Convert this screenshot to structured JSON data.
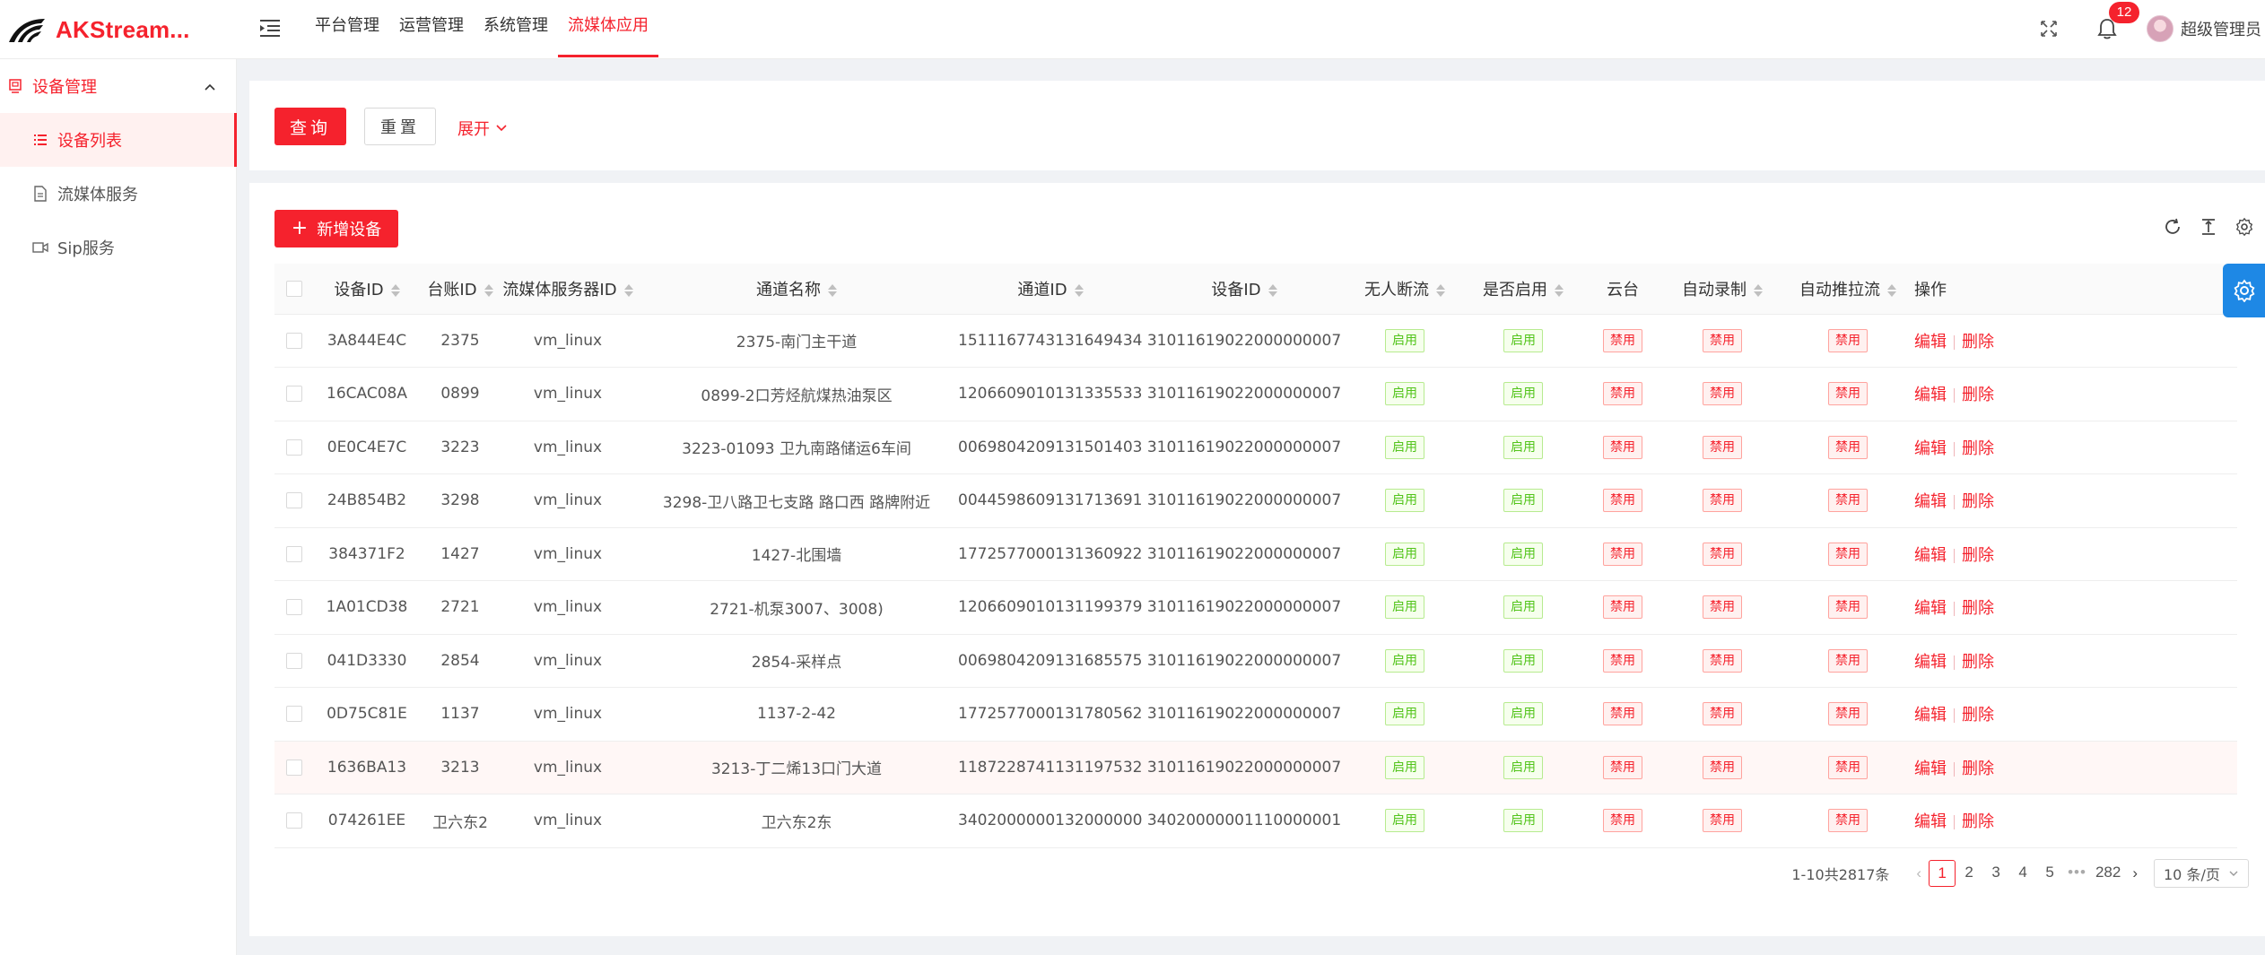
{
  "app": {
    "title": "AKStream..."
  },
  "top_nav": [
    "平台管理",
    "运营管理",
    "系统管理",
    "流媒体应用"
  ],
  "notifications": {
    "count": "12"
  },
  "user": {
    "name": "超级管理员"
  },
  "sidebar": {
    "group_label": "设备管理",
    "items": [
      {
        "label": "设备列表",
        "icon": "list-icon",
        "active": true
      },
      {
        "label": "流媒体服务",
        "icon": "file-icon",
        "active": false
      },
      {
        "label": "Sip服务",
        "icon": "video-icon",
        "active": false
      }
    ]
  },
  "search": {
    "query_label": "查询",
    "reset_label": "重置",
    "expand_label": "展开"
  },
  "toolbar": {
    "add_label": "新增设备"
  },
  "table": {
    "columns": [
      "设备ID",
      "台账ID",
      "流媒体服务器ID",
      "通道名称",
      "通道ID",
      "设备ID",
      "无人断流",
      "是否启用",
      "云台",
      "自动录制",
      "自动推拉流",
      "操作"
    ],
    "rows": [
      {
        "device_id": "3A844E4C",
        "ledger_id": "2375",
        "server_id": "vm_linux",
        "channel_name": "2375-南门主干道",
        "channel_id": "15111677431316494348",
        "dev_id2": "31011619022000000007",
        "no_user_stop": "启用",
        "enabled": "启用",
        "ptz": "禁用",
        "auto_record": "禁用",
        "auto_push": "禁用",
        "edit": "编辑",
        "delete": "删除"
      },
      {
        "device_id": "16CAC08A",
        "ledger_id": "0899",
        "server_id": "vm_linux",
        "channel_name": "0899-2口芳烃航煤热油泵区",
        "channel_id": "12066090101313355338",
        "dev_id2": "31011619022000000007",
        "no_user_stop": "启用",
        "enabled": "启用",
        "ptz": "禁用",
        "auto_record": "禁用",
        "auto_push": "禁用",
        "edit": "编辑",
        "delete": "删除"
      },
      {
        "device_id": "0E0C4E7C",
        "ledger_id": "3223",
        "server_id": "vm_linux",
        "channel_name": "3223-01093 卫九南路储运6车间",
        "channel_id": "00698042091315014038",
        "dev_id2": "31011619022000000007",
        "no_user_stop": "启用",
        "enabled": "启用",
        "ptz": "禁用",
        "auto_record": "禁用",
        "auto_push": "禁用",
        "edit": "编辑",
        "delete": "删除"
      },
      {
        "device_id": "24B854B2",
        "ledger_id": "3298",
        "server_id": "vm_linux",
        "channel_name": "3298-卫八路卫七支路 路口西 路牌附近",
        "channel_id": "00445986091317136918",
        "dev_id2": "31011619022000000007",
        "no_user_stop": "启用",
        "enabled": "启用",
        "ptz": "禁用",
        "auto_record": "禁用",
        "auto_push": "禁用",
        "edit": "编辑",
        "delete": "删除"
      },
      {
        "device_id": "384371F2",
        "ledger_id": "1427",
        "server_id": "vm_linux",
        "channel_name": "1427-北围墙",
        "channel_id": "17725770001313609224",
        "dev_id2": "31011619022000000007",
        "no_user_stop": "启用",
        "enabled": "启用",
        "ptz": "禁用",
        "auto_record": "禁用",
        "auto_push": "禁用",
        "edit": "编辑",
        "delete": "删除"
      },
      {
        "device_id": "1A01CD38",
        "ledger_id": "2721",
        "server_id": "vm_linux",
        "channel_name": "2721-机泵3007、3008)",
        "channel_id": "12066090101311993790",
        "dev_id2": "31011619022000000007",
        "no_user_stop": "启用",
        "enabled": "启用",
        "ptz": "禁用",
        "auto_record": "禁用",
        "auto_push": "禁用",
        "edit": "编辑",
        "delete": "删除"
      },
      {
        "device_id": "041D3330",
        "ledger_id": "2854",
        "server_id": "vm_linux",
        "channel_name": "2854-采样点",
        "channel_id": "00698042091316855750",
        "dev_id2": "31011619022000000007",
        "no_user_stop": "启用",
        "enabled": "启用",
        "ptz": "禁用",
        "auto_record": "禁用",
        "auto_push": "禁用",
        "edit": "编辑",
        "delete": "删除"
      },
      {
        "device_id": "0D75C81E",
        "ledger_id": "1137",
        "server_id": "vm_linux",
        "channel_name": "1137-2-42",
        "channel_id": "17725770001317805620",
        "dev_id2": "31011619022000000007",
        "no_user_stop": "启用",
        "enabled": "启用",
        "ptz": "禁用",
        "auto_record": "禁用",
        "auto_push": "禁用",
        "edit": "编辑",
        "delete": "删除"
      },
      {
        "device_id": "1636BA13",
        "ledger_id": "3213",
        "server_id": "vm_linux",
        "channel_name": "3213-丁二烯13口门大道",
        "channel_id": "11872287411311975327",
        "dev_id2": "31011619022000000007",
        "no_user_stop": "启用",
        "enabled": "启用",
        "ptz": "禁用",
        "auto_record": "禁用",
        "auto_push": "禁用",
        "edit": "编辑",
        "delete": "删除"
      },
      {
        "device_id": "074261EE",
        "ledger_id": "卫六东2",
        "server_id": "vm_linux",
        "channel_name": "卫六东2东",
        "channel_id": "34020000001320000001",
        "dev_id2": "34020000001110000001",
        "no_user_stop": "启用",
        "enabled": "启用",
        "ptz": "禁用",
        "auto_record": "禁用",
        "auto_push": "禁用",
        "edit": "编辑",
        "delete": "删除"
      }
    ]
  },
  "pagination": {
    "total_text": "1-10共2817条",
    "pages": [
      "1",
      "2",
      "3",
      "4",
      "5"
    ],
    "ellipsis": "•••",
    "last_page": "282",
    "current": "1",
    "page_size": "10 条/页"
  },
  "colors": {
    "accent": "#f5222d",
    "success": "#52c41a",
    "float_button": "#1e88e5"
  },
  "icons": [
    "logo-icon",
    "menu-fold-icon",
    "fullscreen-icon",
    "bell-icon",
    "user-avatar",
    "reload-icon",
    "column-height-icon",
    "settings-icon",
    "chevron-up-icon",
    "chevron-down-icon"
  ]
}
